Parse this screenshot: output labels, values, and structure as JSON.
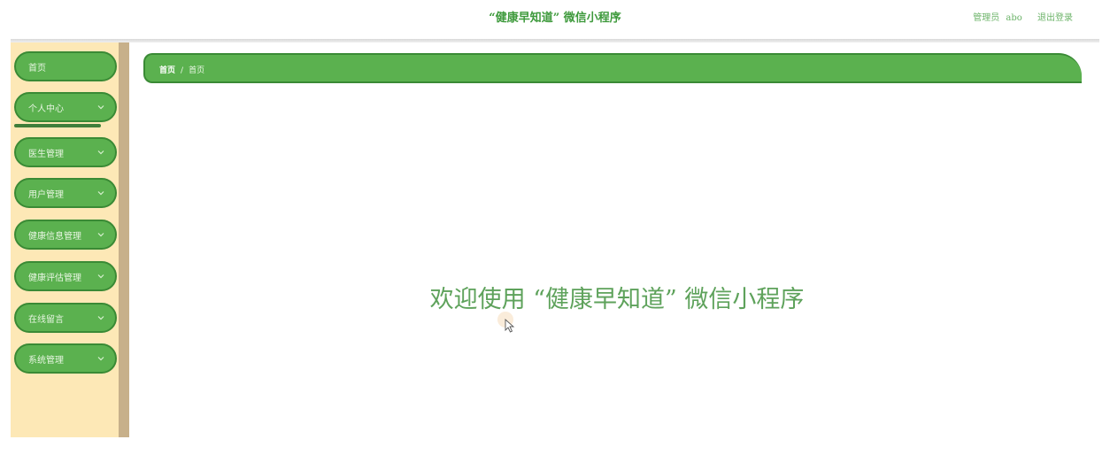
{
  "header": {
    "title": "“健康早知道” 微信小程序",
    "role": "管理员",
    "username": "abo",
    "logout": "退出登录"
  },
  "sidebar": {
    "items": [
      {
        "label": "首页"
      },
      {
        "label": "个人中心"
      },
      {
        "label": "医生管理"
      },
      {
        "label": "用户管理"
      },
      {
        "label": "健康信息管理"
      },
      {
        "label": "健康评估管理"
      },
      {
        "label": "在线留言"
      },
      {
        "label": "系统管理"
      }
    ]
  },
  "breadcrumb": {
    "home": "首页",
    "separator": "/",
    "current": "首页"
  },
  "main": {
    "welcome": "欢迎使用 “健康早知道” 微信小程序"
  },
  "colors": {
    "accent_green": "#5bb14f",
    "border_green": "#3a8a35",
    "sidebar_bg": "#fde8b6",
    "title_green": "#3e9a3c"
  },
  "icons": {
    "expand": "chevron-down-icon",
    "pointer": "mouse-cursor-icon"
  }
}
